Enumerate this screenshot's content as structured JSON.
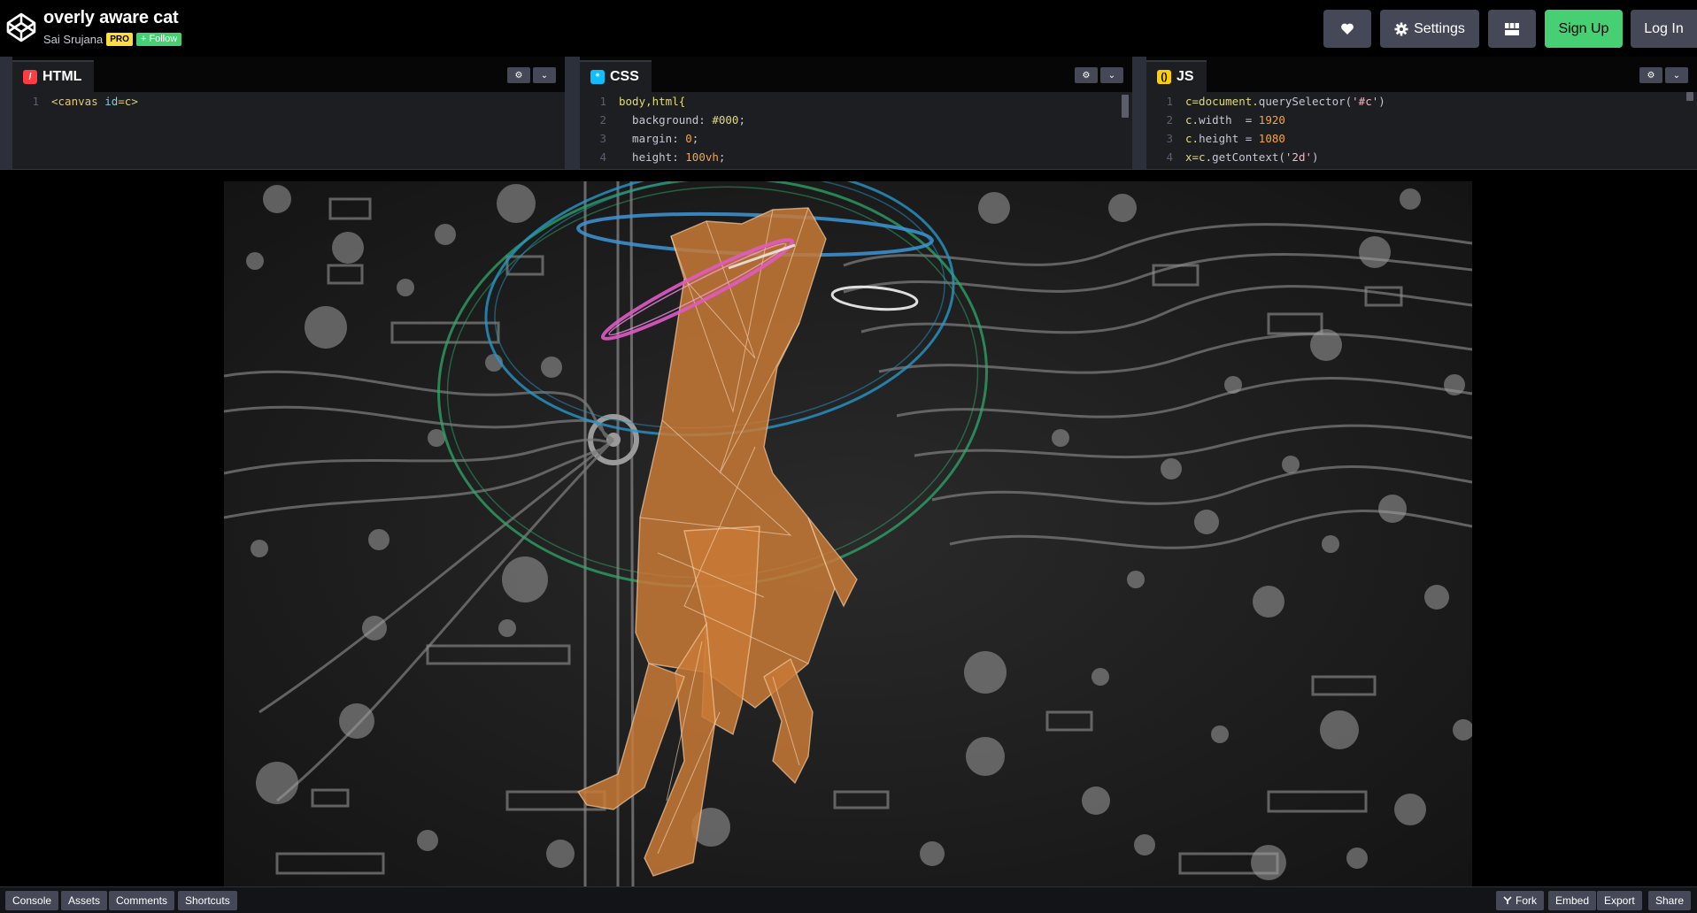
{
  "header": {
    "title": "overly aware cat",
    "author": "Sai Srujana",
    "pro_badge": "PRO",
    "follow_label": "+ Follow",
    "settings_label": "Settings",
    "signup_label": "Sign Up",
    "login_label": "Log In",
    "colors": {
      "signup": "#47cf73",
      "pro": "#ffdd40",
      "button": "#444857"
    }
  },
  "editors": {
    "html": {
      "label": "HTML",
      "icon": "html-icon",
      "lines": [
        {
          "n": "1",
          "tokens": [
            {
              "t": "<canvas ",
              "c": "tag"
            },
            {
              "t": "id",
              "c": "attr"
            },
            {
              "t": "=c>",
              "c": "tag"
            }
          ]
        }
      ]
    },
    "css": {
      "label": "CSS",
      "icon": "css-icon",
      "lines": [
        {
          "n": "1",
          "tokens": [
            {
              "t": "body,html{",
              "c": "sel"
            }
          ]
        },
        {
          "n": "2",
          "tokens": [
            {
              "t": "  background: ",
              "c": "plain"
            },
            {
              "t": "#000",
              "c": "sel"
            },
            {
              "t": ";",
              "c": "plain"
            }
          ]
        },
        {
          "n": "3",
          "tokens": [
            {
              "t": "  margin: ",
              "c": "plain"
            },
            {
              "t": "0",
              "c": "num"
            },
            {
              "t": ";",
              "c": "plain"
            }
          ]
        },
        {
          "n": "4",
          "tokens": [
            {
              "t": "  height: ",
              "c": "plain"
            },
            {
              "t": "100vh",
              "c": "num"
            },
            {
              "t": ";",
              "c": "plain"
            }
          ]
        }
      ]
    },
    "js": {
      "label": "JS",
      "icon": "js-icon",
      "lines": [
        {
          "n": "1",
          "tokens": [
            {
              "t": "c=document.",
              "c": "sel"
            },
            {
              "t": "querySelector(",
              "c": "plain"
            },
            {
              "t": "'#c'",
              "c": "str"
            },
            {
              "t": ")",
              "c": "plain"
            }
          ]
        },
        {
          "n": "2",
          "tokens": [
            {
              "t": "c.",
              "c": "sel"
            },
            {
              "t": "width  = ",
              "c": "plain"
            },
            {
              "t": "1920",
              "c": "num"
            }
          ]
        },
        {
          "n": "3",
          "tokens": [
            {
              "t": "c.",
              "c": "sel"
            },
            {
              "t": "height = ",
              "c": "plain"
            },
            {
              "t": "1080",
              "c": "num"
            }
          ]
        },
        {
          "n": "4",
          "tokens": [
            {
              "t": "x=c.",
              "c": "sel"
            },
            {
              "t": "getContext(",
              "c": "plain"
            },
            {
              "t": "'2d'",
              "c": "str"
            },
            {
              "t": ")",
              "c": "plain"
            }
          ]
        }
      ]
    }
  },
  "footer": {
    "left": [
      "Console",
      "Assets",
      "Comments",
      "Shortcuts"
    ],
    "fork_label": "Fork",
    "embed_label": "Embed",
    "export_label": "Export",
    "share_label": "Share"
  }
}
